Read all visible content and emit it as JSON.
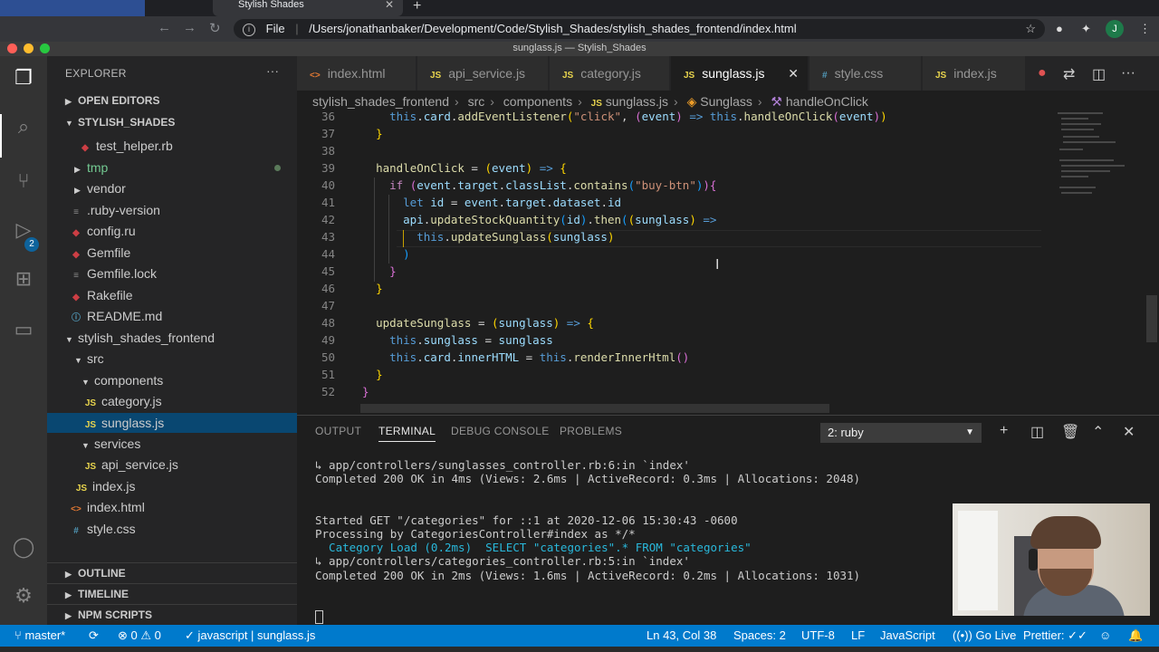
{
  "browser": {
    "tab_title": "Stylish Shades",
    "file_label": "File",
    "url": "/Users/jonathanbaker/Development/Code/Stylish_Shades/stylish_shades_frontend/index.html",
    "avatar_letter": "J"
  },
  "window_title": "sunglass.js — Stylish_Shades",
  "activity_bar": {
    "source_control_badge": "2"
  },
  "sidebar": {
    "title": "EXPLORER",
    "more": "···",
    "sections": {
      "open_editors": "OPEN EDITORS",
      "workspace": "STYLISH_SHADES",
      "outline": "OUTLINE",
      "timeline": "TIMELINE",
      "npm_scripts": "NPM SCRIPTS"
    },
    "tree": [
      {
        "label": "test_helper.rb",
        "icon": "ruby-icon",
        "badge": ""
      },
      {
        "label": "tmp",
        "icon": "folder-icon",
        "badge": ""
      },
      {
        "label": "vendor",
        "icon": "folder-icon",
        "badge": ""
      },
      {
        "label": ".ruby-version",
        "icon": "file-icon",
        "badge": ""
      },
      {
        "label": "config.ru",
        "icon": "ruby-icon",
        "badge": ""
      },
      {
        "label": "Gemfile",
        "icon": "ruby-icon",
        "badge": ""
      },
      {
        "label": "Gemfile.lock",
        "icon": "file-icon",
        "badge": ""
      },
      {
        "label": "Rakefile",
        "icon": "ruby-icon",
        "badge": ""
      },
      {
        "label": "README.md",
        "icon": "info-icon",
        "badge": ""
      },
      {
        "label": "stylish_shades_frontend",
        "icon": "folder-icon",
        "badge": ""
      },
      {
        "label": "src",
        "icon": "folder-icon",
        "badge": ""
      },
      {
        "label": "components",
        "icon": "folder-icon",
        "badge": ""
      },
      {
        "label": "category.js",
        "icon": "js-icon",
        "badge": "JS"
      },
      {
        "label": "sunglass.js",
        "icon": "js-icon",
        "badge": "JS"
      },
      {
        "label": "services",
        "icon": "folder-icon",
        "badge": ""
      },
      {
        "label": "api_service.js",
        "icon": "js-icon",
        "badge": "JS"
      },
      {
        "label": "index.js",
        "icon": "js-icon",
        "badge": "JS"
      },
      {
        "label": "index.html",
        "icon": "html-icon",
        "badge": "<>"
      },
      {
        "label": "style.css",
        "icon": "css-icon",
        "badge": "#"
      }
    ]
  },
  "tabs": [
    {
      "label": "index.html",
      "badge": "<>"
    },
    {
      "label": "api_service.js",
      "badge": "JS"
    },
    {
      "label": "category.js",
      "badge": "JS"
    },
    {
      "label": "sunglass.js",
      "badge": "JS"
    },
    {
      "label": "style.css",
      "badge": "#"
    },
    {
      "label": "index.js",
      "badge": "JS"
    }
  ],
  "breadcrumb": [
    "stylish_shades_frontend",
    "src",
    "components",
    "sunglass.js",
    "Sunglass",
    "handleOnClick"
  ],
  "code": [
    {
      "n": "36",
      "tokens": [
        [
          "pl",
          "    "
        ],
        [
          "this",
          "this"
        ],
        [
          "pl",
          "."
        ],
        [
          "var",
          "card"
        ],
        [
          "pl",
          "."
        ],
        [
          "fn",
          "addEventListener"
        ],
        [
          "p1",
          "("
        ],
        [
          "str",
          "\"click\""
        ],
        [
          "pl",
          ", "
        ],
        [
          "p2",
          "("
        ],
        [
          "var",
          "event"
        ],
        [
          "p2",
          ")"
        ],
        [
          "this",
          " => "
        ],
        [
          "this",
          "this"
        ],
        [
          "pl",
          "."
        ],
        [
          "fn",
          "handleOnClick"
        ],
        [
          "p2",
          "("
        ],
        [
          "var",
          "event"
        ],
        [
          "p2",
          ")"
        ],
        [
          "p1",
          ")"
        ]
      ]
    },
    {
      "n": "37",
      "tokens": [
        [
          "pl",
          "  "
        ],
        [
          "p1",
          "}"
        ]
      ]
    },
    {
      "n": "38",
      "tokens": []
    },
    {
      "n": "39",
      "tokens": [
        [
          "pl",
          "  "
        ],
        [
          "fn",
          "handleOnClick"
        ],
        [
          "pl",
          " = "
        ],
        [
          "p1",
          "("
        ],
        [
          "var",
          "event"
        ],
        [
          "p1",
          ")"
        ],
        [
          "this",
          " => "
        ],
        [
          "p1",
          "{"
        ]
      ]
    },
    {
      "n": "40",
      "tokens": [
        [
          "pl",
          "    "
        ],
        [
          "kw",
          "if"
        ],
        [
          "pl",
          " "
        ],
        [
          "p2",
          "("
        ],
        [
          "var",
          "event"
        ],
        [
          "pl",
          "."
        ],
        [
          "var",
          "target"
        ],
        [
          "pl",
          "."
        ],
        [
          "var",
          "classList"
        ],
        [
          "pl",
          "."
        ],
        [
          "fn",
          "contains"
        ],
        [
          "p3",
          "("
        ],
        [
          "str",
          "\"buy-btn\""
        ],
        [
          "p3",
          ")"
        ],
        [
          "p2",
          ")"
        ],
        [
          "p2",
          "{"
        ]
      ]
    },
    {
      "n": "41",
      "tokens": [
        [
          "pl",
          "      "
        ],
        [
          "this",
          "let"
        ],
        [
          "pl",
          " "
        ],
        [
          "var",
          "id"
        ],
        [
          "pl",
          " = "
        ],
        [
          "var",
          "event"
        ],
        [
          "pl",
          "."
        ],
        [
          "var",
          "target"
        ],
        [
          "pl",
          "."
        ],
        [
          "var",
          "dataset"
        ],
        [
          "pl",
          "."
        ],
        [
          "var",
          "id"
        ]
      ]
    },
    {
      "n": "42",
      "tokens": [
        [
          "pl",
          "      "
        ],
        [
          "var",
          "api"
        ],
        [
          "pl",
          "."
        ],
        [
          "fn",
          "updateStockQuantity"
        ],
        [
          "p3",
          "("
        ],
        [
          "var",
          "id"
        ],
        [
          "p3",
          ")"
        ],
        [
          "pl",
          "."
        ],
        [
          "fn",
          "then"
        ],
        [
          "p3",
          "("
        ],
        [
          "p1",
          "("
        ],
        [
          "var",
          "sunglass"
        ],
        [
          "p1",
          ")"
        ],
        [
          "this",
          " =>"
        ]
      ]
    },
    {
      "n": "43",
      "tokens": [
        [
          "pl",
          "        "
        ],
        [
          "this",
          "this"
        ],
        [
          "pl",
          "."
        ],
        [
          "fn",
          "updateSunglass"
        ],
        [
          "p1",
          "("
        ],
        [
          "var",
          "sunglass"
        ],
        [
          "p1",
          ")"
        ]
      ]
    },
    {
      "n": "44",
      "tokens": [
        [
          "pl",
          "      "
        ],
        [
          "p3",
          ")"
        ]
      ]
    },
    {
      "n": "45",
      "tokens": [
        [
          "pl",
          "    "
        ],
        [
          "p2",
          "}"
        ]
      ]
    },
    {
      "n": "46",
      "tokens": [
        [
          "pl",
          "  "
        ],
        [
          "p1",
          "}"
        ]
      ]
    },
    {
      "n": "47",
      "tokens": []
    },
    {
      "n": "48",
      "tokens": [
        [
          "pl",
          "  "
        ],
        [
          "fn",
          "updateSunglass"
        ],
        [
          "pl",
          " = "
        ],
        [
          "p1",
          "("
        ],
        [
          "var",
          "sunglass"
        ],
        [
          "p1",
          ")"
        ],
        [
          "this",
          " => "
        ],
        [
          "p1",
          "{"
        ]
      ]
    },
    {
      "n": "49",
      "tokens": [
        [
          "pl",
          "    "
        ],
        [
          "this",
          "this"
        ],
        [
          "pl",
          "."
        ],
        [
          "var",
          "sunglass"
        ],
        [
          "pl",
          " = "
        ],
        [
          "var",
          "sunglass"
        ]
      ]
    },
    {
      "n": "50",
      "tokens": [
        [
          "pl",
          "    "
        ],
        [
          "this",
          "this"
        ],
        [
          "pl",
          "."
        ],
        [
          "var",
          "card"
        ],
        [
          "pl",
          "."
        ],
        [
          "var",
          "innerHTML"
        ],
        [
          "pl",
          " = "
        ],
        [
          "this",
          "this"
        ],
        [
          "pl",
          "."
        ],
        [
          "fn",
          "renderInnerHtml"
        ],
        [
          "p2",
          "()"
        ]
      ]
    },
    {
      "n": "51",
      "tokens": [
        [
          "pl",
          "  "
        ],
        [
          "p1",
          "}"
        ]
      ]
    },
    {
      "n": "52",
      "tokens": [
        [
          "p2",
          "}"
        ]
      ]
    }
  ],
  "panel": {
    "tabs": [
      "OUTPUT",
      "TERMINAL",
      "DEBUG CONSOLE",
      "PROBLEMS"
    ],
    "active_tab": "TERMINAL",
    "terminal_select": "2: ruby",
    "lines": [
      {
        "text": "↳ app/controllers/sunglasses_controller.rb:6:in `index'",
        "style": "plain"
      },
      {
        "text": "Completed 200 OK in 4ms (Views: 2.6ms | ActiveRecord: 0.3ms | Allocations: 2048)",
        "style": "plain"
      },
      {
        "text": "",
        "style": "plain"
      },
      {
        "text": "",
        "style": "plain"
      },
      {
        "text": "Started GET \"/categories\" for ::1 at 2020-12-06 15:30:43 -0600",
        "style": "plain"
      },
      {
        "text": "Processing by CategoriesController#index as */*",
        "style": "plain"
      },
      {
        "text": "  Category Load (0.2ms)  SELECT \"categories\".* FROM \"categories\"",
        "style": "cyan"
      },
      {
        "text": "↳ app/controllers/categories_controller.rb:5:in `index'",
        "style": "plain"
      },
      {
        "text": "Completed 200 OK in 2ms (Views: 1.6ms | ActiveRecord: 0.2ms | Allocations: 1031)",
        "style": "plain"
      }
    ]
  },
  "statusbar": {
    "branch": "master*",
    "errors": "0",
    "warnings": "0",
    "language_context": "javascript | sunglass.js",
    "position": "Ln 43, Col 38",
    "spaces": "Spaces: 2",
    "encoding": "UTF-8",
    "eol": "LF",
    "language": "JavaScript",
    "go_live": "Go Live",
    "prettier": "Prettier: ✓✓"
  },
  "colors": {
    "statusbar": "#007acc",
    "selection": "#094771",
    "accent": "#0e639c"
  }
}
